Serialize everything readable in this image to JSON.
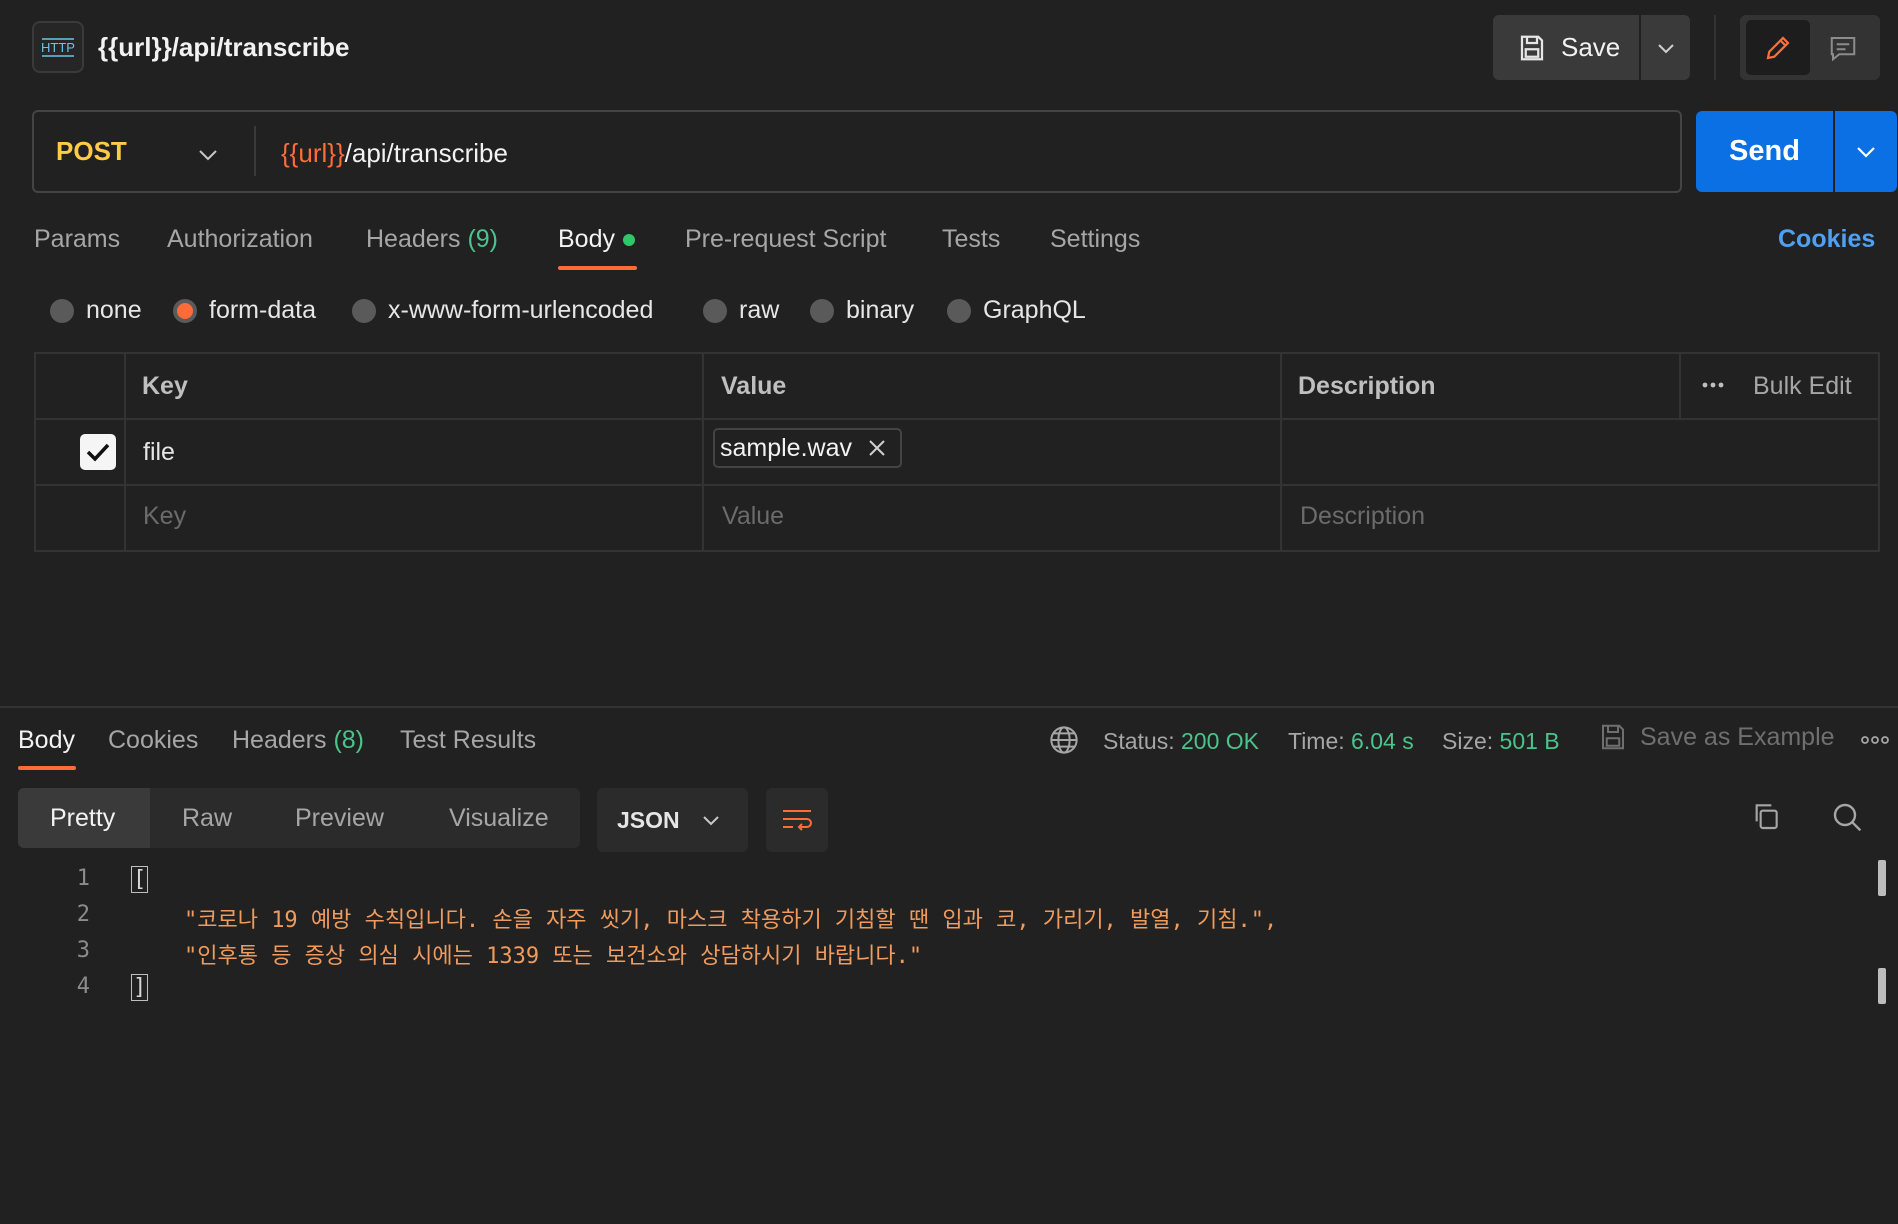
{
  "header": {
    "icon": "http-icon",
    "icon_text": "HTTP",
    "title": "{{url}}/api/transcribe",
    "save_label": "Save"
  },
  "request": {
    "method": "POST",
    "url_var": "{{url}}",
    "url_path": "/api/transcribe",
    "send_label": "Send"
  },
  "tabs": [
    {
      "label": "Params"
    },
    {
      "label": "Authorization"
    },
    {
      "label": "Headers",
      "count": "(9)"
    },
    {
      "label": "Body",
      "active": true
    },
    {
      "label": "Pre-request Script"
    },
    {
      "label": "Tests"
    },
    {
      "label": "Settings"
    }
  ],
  "cookies_label": "Cookies",
  "body_types": [
    {
      "label": "none",
      "selected": false
    },
    {
      "label": "form-data",
      "selected": true
    },
    {
      "label": "x-www-form-urlencoded",
      "selected": false
    },
    {
      "label": "raw",
      "selected": false
    },
    {
      "label": "binary",
      "selected": false
    },
    {
      "label": "GraphQL",
      "selected": false
    }
  ],
  "form_table": {
    "headers": {
      "key": "Key",
      "value": "Value",
      "description": "Description",
      "bulk_edit": "Bulk Edit"
    },
    "rows": [
      {
        "checked": true,
        "key": "file",
        "value": "sample.wav",
        "description": ""
      }
    ],
    "placeholders": {
      "key": "Key",
      "value": "Value",
      "description": "Description"
    }
  },
  "response": {
    "tabs": [
      {
        "label": "Body",
        "active": true
      },
      {
        "label": "Cookies"
      },
      {
        "label": "Headers",
        "count": "(8)"
      },
      {
        "label": "Test Results"
      }
    ],
    "status_label": "Status:",
    "status_value": "200 OK",
    "time_label": "Time:",
    "time_value": "6.04 s",
    "size_label": "Size:",
    "size_value": "501 B",
    "save_example_label": "Save as Example",
    "views": [
      "Pretty",
      "Raw",
      "Preview",
      "Visualize"
    ],
    "format": "JSON",
    "code_lines": [
      {
        "n": "1",
        "text": "["
      },
      {
        "n": "2",
        "text": "    \"코로나 19 예방 수칙입니다. 손을 자주 씻기, 마스크 착용하기 기침할 땐 입과 코, 가리기, 발열, 기침.\","
      },
      {
        "n": "3",
        "text": "    \"인후통 등 증상 의심 시에는 1339 또는 보건소와 상담하시기 바랍니다.\""
      },
      {
        "n": "4",
        "text": "]"
      }
    ]
  },
  "colors": {
    "accent": "#ff6c37",
    "send": "#0c70e5",
    "method": "#ffcb47",
    "status_green": "#4cc38a",
    "link_blue": "#4ea0f2"
  }
}
